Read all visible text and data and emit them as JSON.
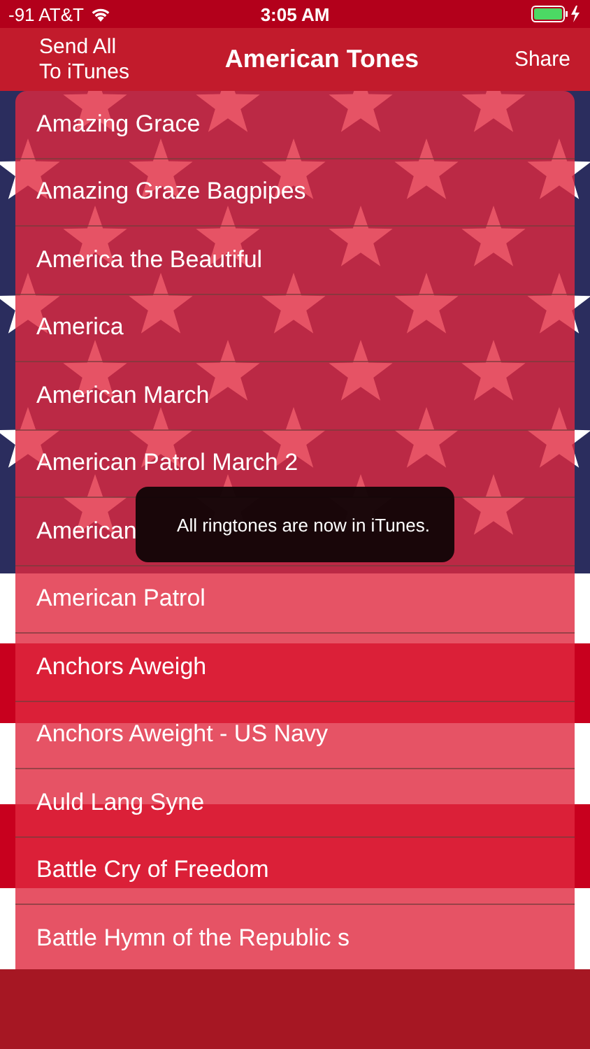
{
  "status_bar": {
    "carrier": "-91 AT&T",
    "time": "3:05 AM"
  },
  "nav": {
    "left_button": "Send All\nTo iTunes",
    "title": "American Tones",
    "right_button": "Share"
  },
  "tones": [
    {
      "title": "Amazing Grace"
    },
    {
      "title": "Amazing Graze Bagpipes"
    },
    {
      "title": "America the Beautiful"
    },
    {
      "title": "America"
    },
    {
      "title": "American March"
    },
    {
      "title": "American Patrol March 2"
    },
    {
      "title": "American"
    },
    {
      "title": "American Patrol"
    },
    {
      "title": "Anchors Aweigh"
    },
    {
      "title": "Anchors Aweight - US Navy"
    },
    {
      "title": "Auld Lang Syne"
    },
    {
      "title": "Battle Cry of Freedom"
    },
    {
      "title": "Battle Hymn of the Republic s"
    }
  ],
  "toast": {
    "message": "All ringtones are now in iTunes."
  }
}
